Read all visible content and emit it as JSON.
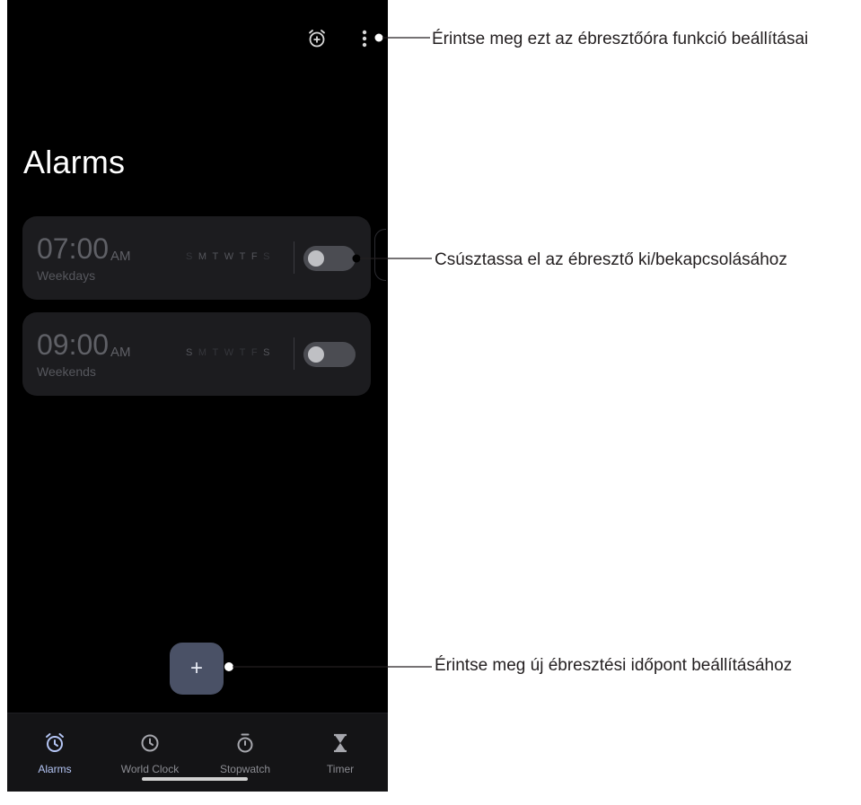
{
  "title": "Alarms",
  "alarms": [
    {
      "time": "07:00",
      "ampm": "AM",
      "label": "Weekdays",
      "days": [
        "S",
        "M",
        "T",
        "W",
        "T",
        "F",
        "S"
      ],
      "active_days": [
        false,
        true,
        true,
        true,
        true,
        true,
        false
      ],
      "enabled": false
    },
    {
      "time": "09:00",
      "ampm": "AM",
      "label": "Weekends",
      "days": [
        "S",
        "M",
        "T",
        "W",
        "T",
        "F",
        "S"
      ],
      "active_days": [
        true,
        false,
        false,
        false,
        false,
        false,
        true
      ],
      "enabled": false
    }
  ],
  "fab": {
    "icon": "plus-icon",
    "label": "+"
  },
  "toolbar": {
    "icons": [
      "add-alarm-icon",
      "more-vert-icon"
    ]
  },
  "nav": {
    "items": [
      {
        "label": "Alarms",
        "icon": "alarm-icon",
        "active": true
      },
      {
        "label": "World Clock",
        "icon": "clock-icon",
        "active": false
      },
      {
        "label": "Stopwatch",
        "icon": "stopwatch-icon",
        "active": false
      },
      {
        "label": "Timer",
        "icon": "hourglass-icon",
        "active": false
      }
    ]
  },
  "callouts": {
    "menu": "Érintse meg ezt az ébresztőóra funkció beállításai",
    "toggle": "Csúsztassa el az ébresztő ki/bekapcsolásához",
    "add": "Érintse meg új ébresztési időpont beállításához"
  },
  "colors": {
    "background": "#000000",
    "card": "#1c1c1f",
    "fab": "#4a5166",
    "active_nav": "#b4c5f4"
  }
}
